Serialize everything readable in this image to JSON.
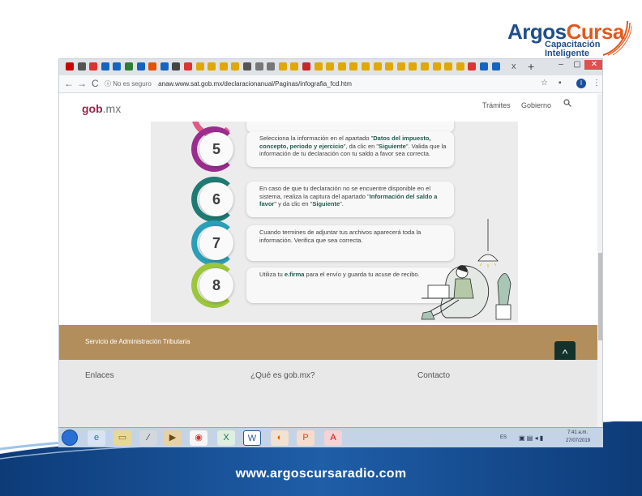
{
  "slide": {
    "brand_name_part1": "Argos",
    "brand_name_part2": "Cursa",
    "brand_tagline_1": "Capacitación",
    "brand_tagline_2": "Inteligente",
    "footer_url": "www.argoscursaradio.com"
  },
  "browser": {
    "tab_close": "x",
    "new_tab": "+",
    "nav": {
      "back": "←",
      "forward": "→",
      "reload": "C",
      "info": "ⓘ"
    },
    "security_label": "No es seguro",
    "url": "anaw.www.sat.gob.mx/declaracionanual/Paginas/infografia_fcd.htm",
    "profile_initial": "I"
  },
  "gob_header": {
    "logo_main": "gob",
    "logo_tld": ".mx",
    "nav_items": [
      "Trámites",
      "Gobierno"
    ],
    "search_icon": "search-icon"
  },
  "steps": [
    {
      "number": "5",
      "ring_color": "#9b2d8f",
      "text_html_parts": [
        {
          "t": "Selecciona la información en el apartado \""
        },
        {
          "b": "Datos del impuesto, concepto, periodo y ejercicio"
        },
        {
          "t": "\", da clic en \""
        },
        {
          "b": "Siguiente"
        },
        {
          "t": "\". Valida que la información de tu declaración con tu saldo a favor sea correcta."
        }
      ]
    },
    {
      "number": "6",
      "ring_color": "#1e7a73",
      "text_html_parts": [
        {
          "t": "En caso de que tu declaración no se encuentre disponible en el sistema, realiza la captura del apartado \""
        },
        {
          "b": "Información del saldo a favor"
        },
        {
          "t": "\" y da clic en \""
        },
        {
          "b": "Siguiente"
        },
        {
          "t": "\"."
        }
      ]
    },
    {
      "number": "7",
      "ring_color": "#2a9fb8",
      "text_html_parts": [
        {
          "t": "Cuando termines de adjuntar tus archivos aparecerá toda la información. Verifica que sea correcta."
        }
      ]
    },
    {
      "number": "8",
      "ring_color": "#9cc63c",
      "text_html_parts": [
        {
          "t": "Utiliza tu "
        },
        {
          "b": "e.firma"
        },
        {
          "t": " para el envío y guarda tu acuse de recibo."
        }
      ]
    }
  ],
  "footer": {
    "sat_label": "Servicio de Administración Tributaria",
    "up_arrow": "^",
    "links": [
      "Enlaces",
      "¿Qué es gob.mx?",
      "Contacto"
    ]
  },
  "taskbar": {
    "language": "ES",
    "time": "7:41 a.m.",
    "date": "27/07/2019"
  },
  "colors": {
    "gob_red": "#9d2449",
    "footer_gold": "#b38e5d",
    "up_button": "#13322b",
    "step_bold": "#235b4e"
  }
}
